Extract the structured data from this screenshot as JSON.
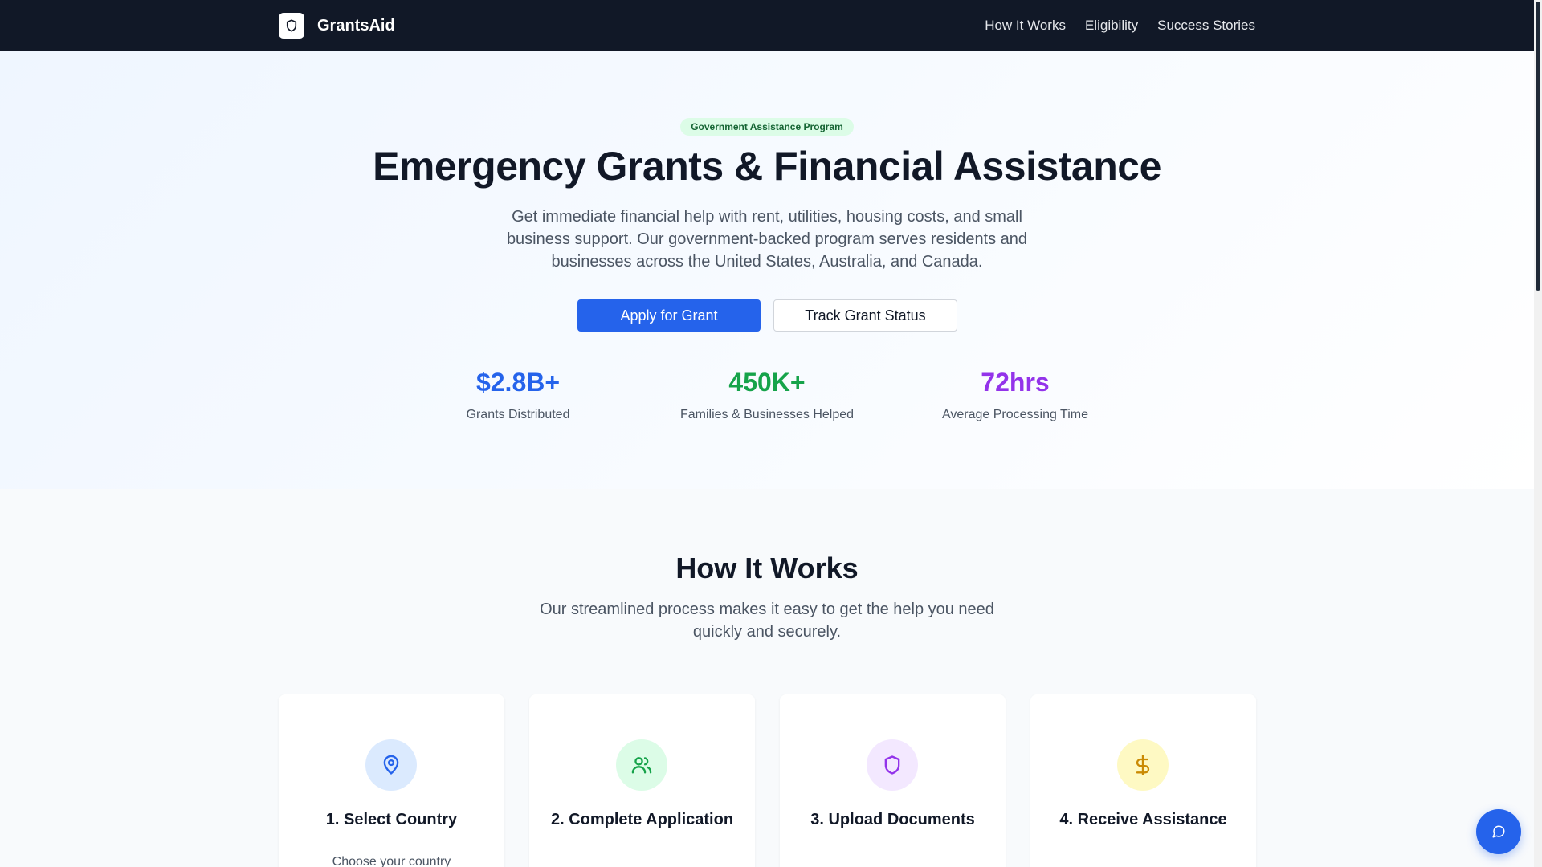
{
  "header": {
    "brand": "GrantsAid",
    "nav": [
      "How It Works",
      "Eligibility",
      "Success Stories"
    ]
  },
  "hero": {
    "badge": "Government Assistance Program",
    "title": "Emergency Grants & Financial Assistance",
    "description": "Get immediate financial help with rent, utilities, housing costs, and small business support. Our government-backed program serves residents and businesses across the United States, Australia, and Canada.",
    "primary_button": "Apply for Grant",
    "secondary_button": "Track Grant Status",
    "stats": [
      {
        "value": "$2.8B+",
        "label": "Grants Distributed",
        "color": "#2563eb"
      },
      {
        "value": "450K+",
        "label": "Families & Businesses Helped",
        "color": "#16a34a"
      },
      {
        "value": "72hrs",
        "label": "Average Processing Time",
        "color": "#9333ea"
      }
    ]
  },
  "how_it_works": {
    "title": "How It Works",
    "description": "Our streamlined process makes it easy to get the help you need quickly and securely.",
    "steps": [
      {
        "title": "1. Select Country",
        "text": "Choose your country",
        "icon": "map-pin-icon",
        "bg": "#dbeafe",
        "fg": "#2563eb"
      },
      {
        "title": "2. Complete Application",
        "text": "",
        "icon": "users-icon",
        "bg": "#dcfce7",
        "fg": "#16a34a"
      },
      {
        "title": "3. Upload Documents",
        "text": "",
        "icon": "shield-icon",
        "bg": "#f3e8ff",
        "fg": "#9333ea"
      },
      {
        "title": "4. Receive Assistance",
        "text": "",
        "icon": "dollar-icon",
        "bg": "#fef9c3",
        "fg": "#ca8a04"
      }
    ]
  },
  "colors": {
    "header_bg": "#111827",
    "primary": "#2563eb"
  }
}
